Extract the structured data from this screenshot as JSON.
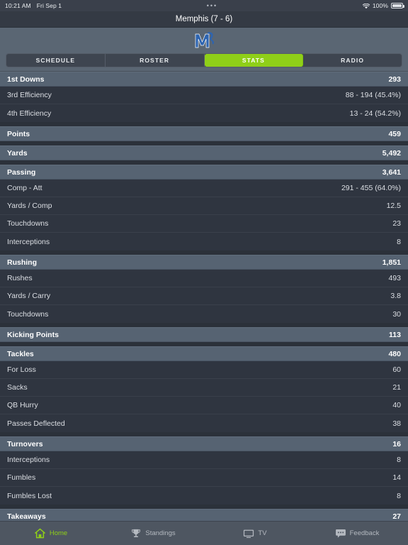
{
  "statusbar": {
    "time": "10:21 AM",
    "date": "Fri Sep 1",
    "center_indicator": "•••",
    "wifi_icon": "wifi-icon",
    "battery_percent": "100%",
    "battery_icon": "battery-full-icon"
  },
  "titlebar": {
    "title": "Memphis (7 - 6)"
  },
  "team_header": {
    "logo_icon": "memphis-tigers-logo",
    "logo_color": "#2d64b0",
    "tabs": [
      {
        "label": "SCHEDULE",
        "active": false
      },
      {
        "label": "ROSTER",
        "active": false
      },
      {
        "label": "STATS",
        "active": true
      },
      {
        "label": "RADIO",
        "active": false
      }
    ],
    "active_color": "#8fcf18"
  },
  "stats": {
    "sections": [
      {
        "header": {
          "label": "1st Downs",
          "value": "293"
        },
        "rows": [
          {
            "label": "3rd Efficiency",
            "value": "88 - 194 (45.4%)"
          },
          {
            "label": "4th Efficiency",
            "value": "13 - 24 (54.2%)"
          }
        ]
      },
      {
        "header": {
          "label": "Points",
          "value": "459"
        },
        "rows": []
      },
      {
        "header": {
          "label": "Yards",
          "value": "5,492"
        },
        "rows": []
      },
      {
        "header": {
          "label": "Passing",
          "value": "3,641"
        },
        "rows": [
          {
            "label": "Comp - Att",
            "value": "291 - 455 (64.0%)"
          },
          {
            "label": "Yards / Comp",
            "value": "12.5"
          },
          {
            "label": "Touchdowns",
            "value": "23"
          },
          {
            "label": "Interceptions",
            "value": "8"
          }
        ]
      },
      {
        "header": {
          "label": "Rushing",
          "value": "1,851"
        },
        "rows": [
          {
            "label": "Rushes",
            "value": "493"
          },
          {
            "label": "Yards / Carry",
            "value": "3.8"
          },
          {
            "label": "Touchdowns",
            "value": "30"
          }
        ]
      },
      {
        "header": {
          "label": "Kicking Points",
          "value": "113"
        },
        "rows": []
      },
      {
        "header": {
          "label": "Tackles",
          "value": "480"
        },
        "rows": [
          {
            "label": "For Loss",
            "value": "60"
          },
          {
            "label": "Sacks",
            "value": "21"
          },
          {
            "label": "QB Hurry",
            "value": "40"
          },
          {
            "label": "Passes Deflected",
            "value": "38"
          }
        ]
      },
      {
        "header": {
          "label": "Turnovers",
          "value": "16"
        },
        "rows": [
          {
            "label": "Interceptions",
            "value": "8"
          },
          {
            "label": "Fumbles",
            "value": "14"
          },
          {
            "label": "Fumbles Lost",
            "value": "8"
          }
        ]
      },
      {
        "header": {
          "label": "Takeaways",
          "value": "27"
        },
        "rows": []
      }
    ]
  },
  "tabbar": {
    "items": [
      {
        "label": "Home",
        "icon": "home-icon",
        "active": true
      },
      {
        "label": "Standings",
        "icon": "trophy-icon",
        "active": false
      },
      {
        "label": "TV",
        "icon": "tv-icon",
        "active": false
      },
      {
        "label": "Feedback",
        "icon": "feedback-bubble-icon",
        "active": false
      }
    ]
  }
}
